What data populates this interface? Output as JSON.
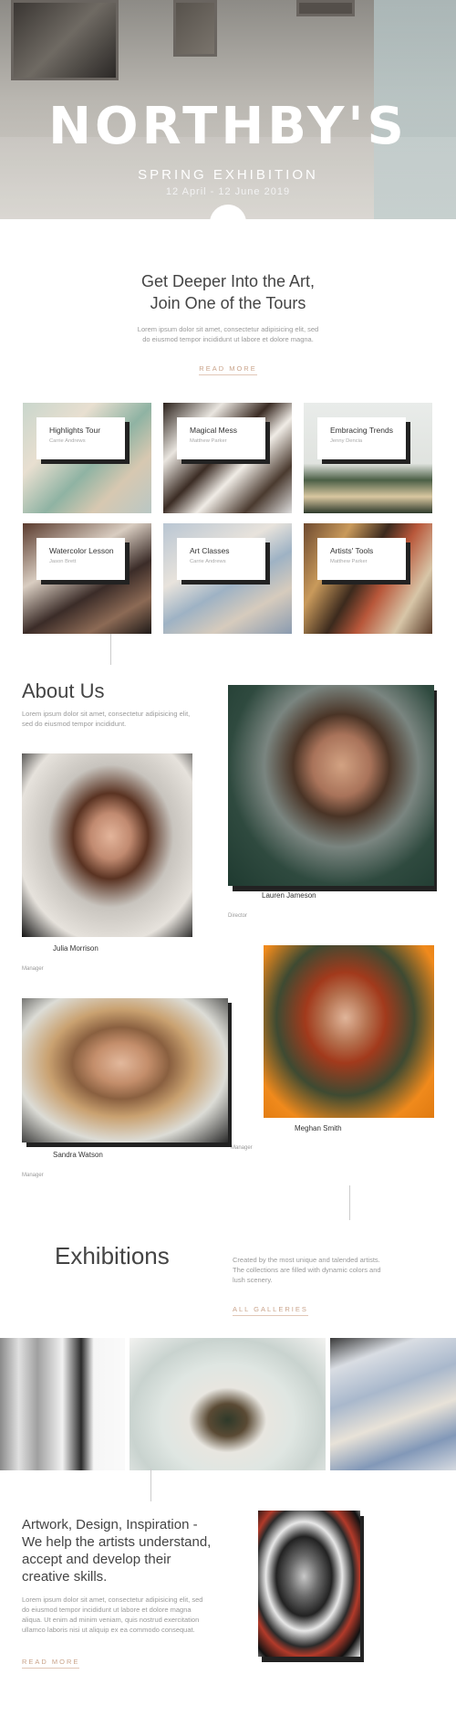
{
  "hero": {
    "title": "NORTHBY'S",
    "subtitle": "SPRING EXHIBITION",
    "dates": "12 April - 12 June 2019"
  },
  "tours_section": {
    "heading_line1": "Get Deeper Into the Art,",
    "heading_line2": "Join One of the Tours",
    "text_line1": "Lorem ipsum dolor sit amet, consectetur adipisicing elit, sed",
    "text_line2": "do eiusmod tempor incididunt ut labore et dolore magna.",
    "read_more": "READ MORE",
    "tours": [
      {
        "title": "Highlights Tour",
        "author": "Carrie Andrews"
      },
      {
        "title": "Magical Mess",
        "author": "Matthew Parker"
      },
      {
        "title": "Embracing Trends",
        "author": "Jenny Dencia"
      },
      {
        "title": "Watercolor Lesson",
        "author": "Jason Brett"
      },
      {
        "title": "Art Classes",
        "author": "Carrie Andrews"
      },
      {
        "title": "Artists' Tools",
        "author": "Matthew Parker"
      }
    ]
  },
  "about": {
    "heading": "About Us",
    "text_line1": "Lorem ipsum dolor sit amet, consectetur adipisicing elit,",
    "text_line2": "sed do eiusmod tempor incididunt.",
    "team": [
      {
        "name": "Lauren Jameson",
        "role": "Director"
      },
      {
        "name": "Julia Morrison",
        "role": "Manager"
      },
      {
        "name": "Meghan Smith",
        "role": "Manager"
      },
      {
        "name": "Sandra Watson",
        "role": "Manager"
      }
    ]
  },
  "exhibitions": {
    "heading": "Exhibitions",
    "text_line1": "Created by the most unique and talended artists.",
    "text_line2": "The collections are filled with dynamic colors and",
    "text_line3": "lush scenery.",
    "link": "ALL GALLERIES"
  },
  "inspiration": {
    "heading_line1": "Artwork, Design, Inspiration -",
    "heading_line2": "We help the artists understand,",
    "heading_line3": "accept and develop their",
    "heading_line4": "creative skills.",
    "text_line1": "Lorem ipsum dolor sit amet, consectetur adipisicing elit, sed",
    "text_line2": "do eiusmod tempor incididunt ut labore et dolore magna",
    "text_line3": "aliqua. Ut enim ad minim veniam, quis nostrud exercitation",
    "text_line4": "ullamco laboris nisi ut aliquip ex ea commodo consequat.",
    "read_more": "READ MORE"
  },
  "colors": {
    "accent": "#c9a38a",
    "text": "#333333",
    "muted": "#9a9a9a"
  }
}
